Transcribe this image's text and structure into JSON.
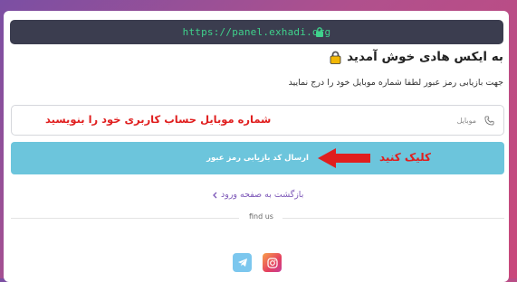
{
  "url_bar": {
    "url": "https://panel.exhadi.org"
  },
  "login": {
    "title": "به ایکس هادی خوش آمدید",
    "subtitle": "جهت بازیابی رمز عبور لطفا شماره موبایل خود را درج نمایید",
    "phone_placeholder": "موبایل",
    "phone_annotation": "شماره موبایل حساب کاربری خود را بنویسید",
    "send_button_label": "ارسال کد بازیابی رمز عبور",
    "click_annotation": "کلیک کنید",
    "back_link": "بازگشت به صفحه ورود",
    "find_us": "find us"
  },
  "icons": {
    "url_lock": "lock-icon",
    "title_lock": "padlock-emoji-icon",
    "phone": "phone-icon",
    "back": "chevron-left-icon",
    "telegram": "telegram-icon",
    "instagram": "instagram-icon"
  },
  "colors": {
    "url_bar_bg": "#3b3d4f",
    "url_text": "#3fd28c",
    "button_bg": "#6cc5dc",
    "annotation_red": "#e01e1e",
    "link_purple": "#7d58b8"
  }
}
